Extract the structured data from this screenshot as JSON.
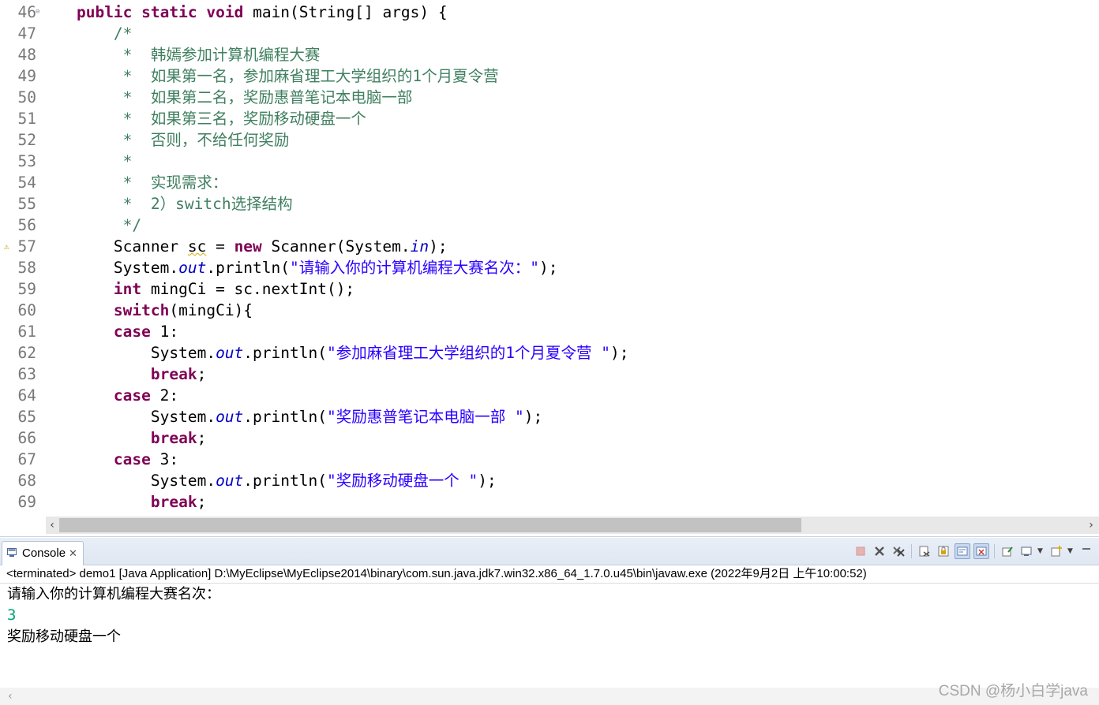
{
  "editor": {
    "lines": [
      {
        "num": "46",
        "fold": true,
        "warn": false,
        "segments": [
          {
            "t": "    ",
            "c": ""
          },
          {
            "t": "public",
            "c": "kw"
          },
          {
            "t": " ",
            "c": ""
          },
          {
            "t": "static",
            "c": "kw"
          },
          {
            "t": " ",
            "c": ""
          },
          {
            "t": "void",
            "c": "kw"
          },
          {
            "t": " main(String[] args) {",
            "c": ""
          }
        ]
      },
      {
        "num": "47",
        "segments": [
          {
            "t": "        /*",
            "c": "cm"
          }
        ]
      },
      {
        "num": "48",
        "segments": [
          {
            "t": "         *  ",
            "c": "cm"
          },
          {
            "t": "韩嫣参加计算机编程大赛",
            "c": "cm cjk"
          }
        ]
      },
      {
        "num": "49",
        "segments": [
          {
            "t": "         *  ",
            "c": "cm"
          },
          {
            "t": "如果第一名，参加麻省理工大学组织的",
            "c": "cm cjk"
          },
          {
            "t": "1",
            "c": "cm"
          },
          {
            "t": "个月夏令营",
            "c": "cm cjk"
          }
        ]
      },
      {
        "num": "50",
        "segments": [
          {
            "t": "         *  ",
            "c": "cm"
          },
          {
            "t": "如果第二名，奖励惠普笔记本电脑一部",
            "c": "cm cjk"
          }
        ]
      },
      {
        "num": "51",
        "segments": [
          {
            "t": "         *  ",
            "c": "cm"
          },
          {
            "t": "如果第三名，奖励移动硬盘一个",
            "c": "cm cjk"
          }
        ]
      },
      {
        "num": "52",
        "segments": [
          {
            "t": "         *  ",
            "c": "cm"
          },
          {
            "t": "否则，不给任何奖励",
            "c": "cm cjk"
          }
        ]
      },
      {
        "num": "53",
        "segments": [
          {
            "t": "         *",
            "c": "cm"
          }
        ]
      },
      {
        "num": "54",
        "segments": [
          {
            "t": "         *  ",
            "c": "cm"
          },
          {
            "t": "实现需求：",
            "c": "cm cjk"
          }
        ]
      },
      {
        "num": "55",
        "segments": [
          {
            "t": "         *  2",
            "c": "cm"
          },
          {
            "t": "）",
            "c": "cm cjk"
          },
          {
            "t": "switch",
            "c": "cm"
          },
          {
            "t": "选择结构",
            "c": "cm cjk"
          }
        ]
      },
      {
        "num": "56",
        "segments": [
          {
            "t": "         */",
            "c": "cm"
          }
        ]
      },
      {
        "num": "57",
        "warn": true,
        "segments": [
          {
            "t": "        Scanner ",
            "c": ""
          },
          {
            "t": "sc",
            "c": "squig"
          },
          {
            "t": " = ",
            "c": ""
          },
          {
            "t": "new",
            "c": "kw"
          },
          {
            "t": " Scanner(System.",
            "c": ""
          },
          {
            "t": "in",
            "c": "field"
          },
          {
            "t": ");",
            "c": ""
          }
        ]
      },
      {
        "num": "58",
        "segments": [
          {
            "t": "        System.",
            "c": ""
          },
          {
            "t": "out",
            "c": "field"
          },
          {
            "t": ".println(",
            "c": ""
          },
          {
            "t": "\"",
            "c": "str"
          },
          {
            "t": "请输入你的计算机编程大赛名次：",
            "c": "str cjk"
          },
          {
            "t": "\"",
            "c": "str"
          },
          {
            "t": ");",
            "c": ""
          }
        ]
      },
      {
        "num": "59",
        "segments": [
          {
            "t": "        ",
            "c": ""
          },
          {
            "t": "int",
            "c": "kw"
          },
          {
            "t": " mingCi = sc.nextInt();",
            "c": ""
          }
        ]
      },
      {
        "num": "60",
        "segments": [
          {
            "t": "        ",
            "c": ""
          },
          {
            "t": "switch",
            "c": "kw"
          },
          {
            "t": "(mingCi){",
            "c": ""
          }
        ]
      },
      {
        "num": "61",
        "segments": [
          {
            "t": "        ",
            "c": ""
          },
          {
            "t": "case",
            "c": "kw"
          },
          {
            "t": " 1:",
            "c": ""
          }
        ]
      },
      {
        "num": "62",
        "segments": [
          {
            "t": "            System.",
            "c": ""
          },
          {
            "t": "out",
            "c": "field"
          },
          {
            "t": ".println(",
            "c": ""
          },
          {
            "t": "\"",
            "c": "str"
          },
          {
            "t": "参加麻省理工大学组织的",
            "c": "str cjk"
          },
          {
            "t": "1",
            "c": "str"
          },
          {
            "t": "个月夏令营",
            "c": "str cjk"
          },
          {
            "t": " \"",
            "c": "str"
          },
          {
            "t": ");",
            "c": ""
          }
        ]
      },
      {
        "num": "63",
        "segments": [
          {
            "t": "            ",
            "c": ""
          },
          {
            "t": "break",
            "c": "kw"
          },
          {
            "t": ";",
            "c": ""
          }
        ]
      },
      {
        "num": "64",
        "segments": [
          {
            "t": "        ",
            "c": ""
          },
          {
            "t": "case",
            "c": "kw"
          },
          {
            "t": " 2:",
            "c": ""
          }
        ]
      },
      {
        "num": "65",
        "segments": [
          {
            "t": "            System.",
            "c": ""
          },
          {
            "t": "out",
            "c": "field"
          },
          {
            "t": ".println(",
            "c": ""
          },
          {
            "t": "\"",
            "c": "str"
          },
          {
            "t": "奖励惠普笔记本电脑一部",
            "c": "str cjk"
          },
          {
            "t": " \"",
            "c": "str"
          },
          {
            "t": ");",
            "c": ""
          }
        ]
      },
      {
        "num": "66",
        "segments": [
          {
            "t": "            ",
            "c": ""
          },
          {
            "t": "break",
            "c": "kw"
          },
          {
            "t": ";",
            "c": ""
          }
        ]
      },
      {
        "num": "67",
        "segments": [
          {
            "t": "        ",
            "c": ""
          },
          {
            "t": "case",
            "c": "kw"
          },
          {
            "t": " 3:",
            "c": ""
          }
        ]
      },
      {
        "num": "68",
        "segments": [
          {
            "t": "            System.",
            "c": ""
          },
          {
            "t": "out",
            "c": "field"
          },
          {
            "t": ".println(",
            "c": ""
          },
          {
            "t": "\"",
            "c": "str"
          },
          {
            "t": "奖励移动硬盘一个",
            "c": "str cjk"
          },
          {
            "t": " \"",
            "c": "str"
          },
          {
            "t": ");",
            "c": ""
          }
        ]
      },
      {
        "num": "69",
        "segments": [
          {
            "t": "            ",
            "c": ""
          },
          {
            "t": "break",
            "c": "kw"
          },
          {
            "t": ";",
            "c": ""
          }
        ]
      }
    ]
  },
  "console": {
    "tab_label": "Console",
    "tab_close": "✕",
    "status": "<terminated> demo1 [Java Application] D:\\MyEclipse\\MyEclipse2014\\binary\\com.sun.java.jdk7.win32.x86_64_1.7.0.u45\\bin\\javaw.exe (2022年9月2日 上午10:00:52)",
    "output": [
      {
        "text": "请输入你的计算机编程大赛名次：",
        "kind": "stdout"
      },
      {
        "text": "3",
        "kind": "input"
      },
      {
        "text": "奖励移动硬盘一个",
        "kind": "stdout"
      }
    ],
    "toolbar_icons": [
      "terminate-icon",
      "remove-launch-icon",
      "remove-all-terminated-icon",
      "clear-console-icon",
      "scroll-lock-icon",
      "word-wrap-icon",
      "show-on-output-icon",
      "pin-console-icon",
      "display-console-icon",
      "new-console-icon",
      "view-menu-icon"
    ]
  },
  "watermark": "CSDN @杨小白学java",
  "colors": {
    "keyword": "#7f0055",
    "comment": "#3f7f5f",
    "string": "#2a00ff",
    "field": "#0000c0",
    "input": "#00a37a"
  }
}
